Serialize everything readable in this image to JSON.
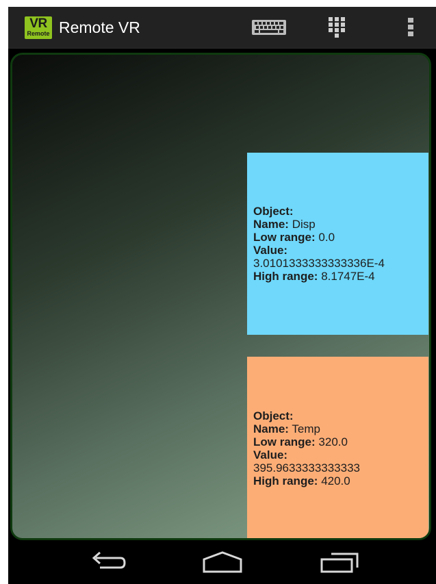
{
  "app": {
    "logo_main": "VR",
    "logo_sub": "Remote",
    "title": "Remote VR"
  },
  "action_bar": {
    "icons": [
      "keyboard-icon",
      "keypad-icon",
      "overflow-menu-icon"
    ]
  },
  "cards": [
    {
      "color": "#6fd8fb",
      "object_label": "Object:",
      "name_label": "Name:",
      "name": "Disp",
      "low_label": "Low range:",
      "low": "0.0",
      "value_label": "Value:",
      "value": "3.0101333333333336E-4",
      "high_label": "High range:",
      "high": "8.1747E-4"
    },
    {
      "color": "#fcad76",
      "object_label": "Object:",
      "name_label": "Name:",
      "name": "Temp",
      "low_label": "Low range:",
      "low": "320.0",
      "value_label": "Value:",
      "value": "395.9633333333333",
      "high_label": "High range:",
      "high": "420.0"
    }
  ],
  "nav_bar": {
    "icons": [
      "back-icon",
      "home-icon",
      "recent-apps-icon"
    ]
  }
}
